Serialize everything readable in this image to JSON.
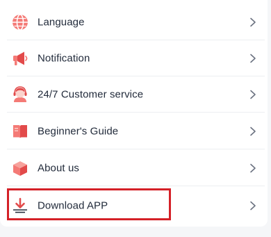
{
  "menu": {
    "items": [
      {
        "label": "Language",
        "icon": "globe-icon"
      },
      {
        "label": "Notification",
        "icon": "megaphone-icon"
      },
      {
        "label": "24/7 Customer service",
        "icon": "headset-agent-icon"
      },
      {
        "label": "Beginner's Guide",
        "icon": "book-icon"
      },
      {
        "label": "About us",
        "icon": "cube-icon"
      },
      {
        "label": "Download APP",
        "icon": "download-icon"
      }
    ],
    "highlighted_item": "Download APP"
  },
  "colors": {
    "accent": "#f06a6a",
    "accent_dark": "#e24a4a",
    "text": "#222b3b",
    "highlight_border": "#d42027",
    "chevron": "#6b7280"
  }
}
